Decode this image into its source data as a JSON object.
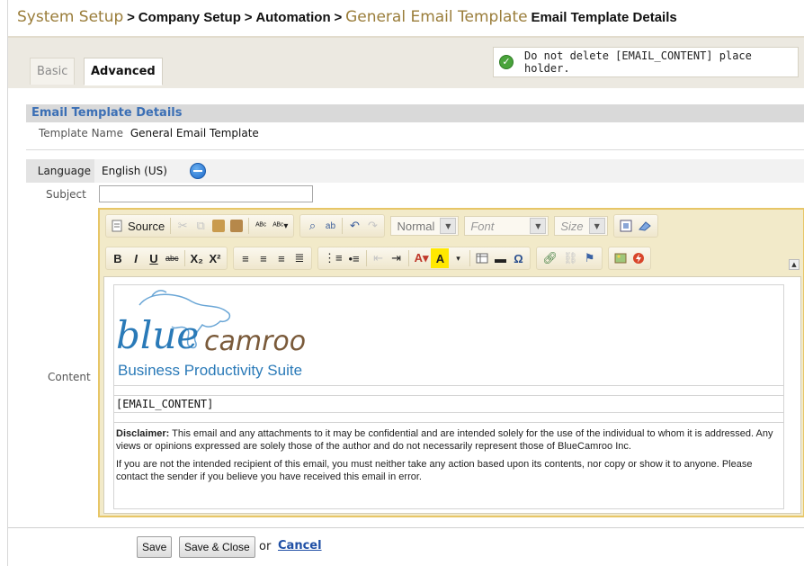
{
  "breadcrumb": {
    "system_setup": "System Setup",
    "separator": ">",
    "company_setup": "Company Setup",
    "automation": "Automation",
    "current": "General Email Template",
    "page_title": "Email Template Details"
  },
  "tabs": [
    {
      "label": "Basic",
      "active": false
    },
    {
      "label": "Advanced",
      "active": true
    }
  ],
  "notice": {
    "icon": "check-circle-icon",
    "text": "Do not delete [EMAIL_CONTENT] place holder."
  },
  "section": {
    "title": "Email Template Details",
    "template_name_label": "Template Name",
    "template_name_value": "General Email Template"
  },
  "form": {
    "language_label": "Language",
    "language_value": "English (US)",
    "language_icon": "remove-circle-icon",
    "subject_label": "Subject",
    "subject_value": "",
    "content_label": "Content"
  },
  "editor": {
    "toolbar1": {
      "source_label": "Source",
      "format_value": "Normal",
      "font_placeholder": "Font",
      "size_placeholder": "Size"
    },
    "toolbar2": {
      "bold": "B",
      "italic": "I",
      "underline": "U",
      "strike": "abc",
      "subscript": "X₂",
      "superscript": "X²"
    },
    "body": {
      "logo_word_blue": "blue",
      "logo_word_camroo": "camroo",
      "logo_tagline": "Business Productivity Suite",
      "placeholder": "[EMAIL_CONTENT]",
      "disclaimer_label": "Disclaimer:",
      "disclaimer_text": " This email and any attachments to it may be confidential and are intended solely for the use of the individual to whom it is addressed. Any views or opinions expressed are solely those of the author and do not necessarily represent those of BlueCamroo Inc.",
      "disclaimer_text2": "If you are not the intended recipient of this email, you must neither take any action based upon its contents, nor copy or show it to anyone. Please contact the sender if you believe you have received this email in error."
    }
  },
  "footer": {
    "save_label": "Save",
    "save_close_label": "Save & Close",
    "or_label": "or",
    "cancel_label": "Cancel"
  },
  "colors": {
    "breadcrumb_gold": "#9a7d3a",
    "section_title_blue": "#3b6fb5",
    "editor_border": "#e7c667",
    "logo_blue": "#2a7ab8",
    "logo_brown": "#7a5a3a"
  }
}
